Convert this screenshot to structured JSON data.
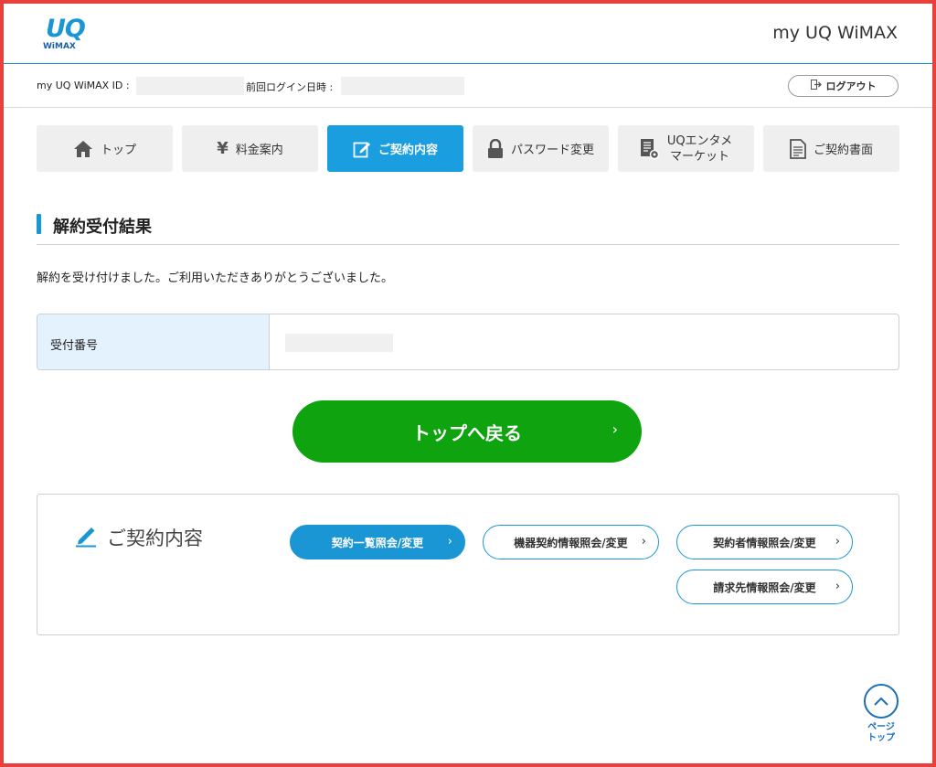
{
  "header": {
    "logo_main": "UQ",
    "logo_sub": "WiMAX",
    "site_title": "my UQ WiMAX"
  },
  "infobar": {
    "id_label": "my UQ WiMAX ID :",
    "last_login_label": "前回ログイン日時 :",
    "logout_label": "ログアウト"
  },
  "nav": {
    "top": "トップ",
    "fees": "料金案内",
    "contract": "ご契約内容",
    "password": "パスワード変更",
    "market_line1": "UQエンタメ",
    "market_line2": "マーケット",
    "documents": "ご契約書面"
  },
  "section": {
    "title": "解約受付結果",
    "message": "解約を受け付けました。ご利用いただきありがとうございました。",
    "receipt_label": "受付番号"
  },
  "main_button": {
    "label": "トップへ戻る",
    "chevron": "›"
  },
  "contract_box": {
    "title": "ご契約内容",
    "buttons": {
      "list": "契約一覧照会/変更",
      "device": "機器契約情報照会/変更",
      "holder": "契約者情報照会/変更",
      "billing": "請求先情報照会/変更"
    },
    "chevron": "›"
  },
  "page_top": {
    "line1": "ページ",
    "line2": "トップ"
  },
  "colors": {
    "accent": "#1a96d4",
    "active_tab": "#1a9ee0",
    "green_button": "#0ea30f",
    "frame": "#e8413b",
    "table_header": "#e3f2fc"
  }
}
